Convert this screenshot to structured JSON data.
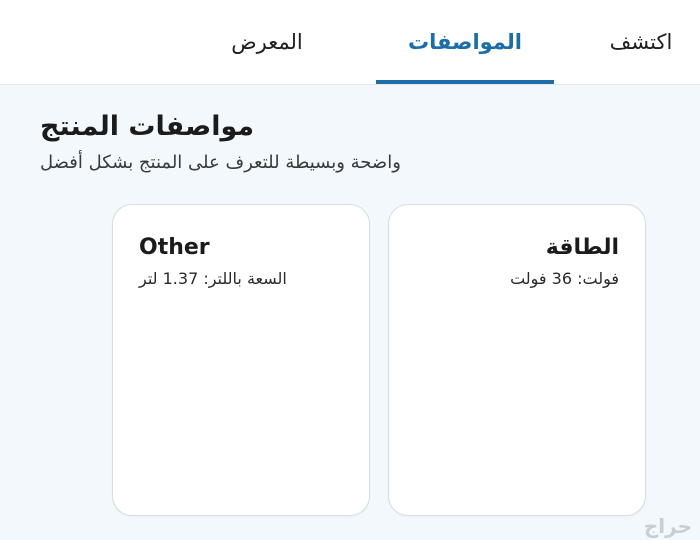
{
  "tabs": [
    {
      "label": "اكتشف"
    },
    {
      "label": "المواصفات"
    },
    {
      "label": "المعرض"
    }
  ],
  "section": {
    "title": "مواصفات المنتج",
    "subtitle": "واضحة وبسيطة للتعرف على المنتج بشكل أفضل"
  },
  "cards": [
    {
      "title": "الطاقة",
      "value": "فولت: 36 فولت"
    },
    {
      "title": "Other",
      "value": "السعة باللتر: 1.37 لتر"
    }
  ],
  "watermark": "حراج",
  "colors": {
    "accent": "#1d6ea6",
    "background": "#f2f8fc"
  }
}
